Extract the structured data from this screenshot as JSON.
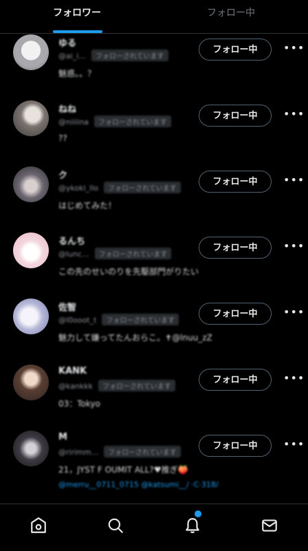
{
  "tabs": [
    {
      "label": "フォロワー"
    },
    {
      "label": "フォロー中"
    }
  ],
  "follow_label": "フォロー中",
  "more_label": "•••",
  "users": [
    {
      "name": "ゆる",
      "handle": "@ai_i...",
      "badge": "フォローされています",
      "bio": "魅惑。。？",
      "bio2": ""
    },
    {
      "name": "ねね",
      "handle": "@niiiina",
      "badge": "フォローされています",
      "bio": "??",
      "bio2": ""
    },
    {
      "name": "ク",
      "handle": "@ykoki_llo",
      "badge": "フォローされています",
      "bio": "はじめてみた！",
      "bio2": ""
    },
    {
      "name": "るんち",
      "handle": "@lunc...",
      "badge": "フォローされています",
      "bio": "この先のせいのりを先駆部門がりたい",
      "bio2": ""
    },
    {
      "name": "佐智",
      "handle": "@l0ooot_t",
      "badge": "フォローされています",
      "bio": "魅力して嫌ってたんおらこ。✝@lnuu_zZ",
      "bio2": ""
    },
    {
      "name": "KANK",
      "handle": "@kankkk",
      "badge": "フォローされています",
      "bio": "03：Tokyo",
      "bio2": ""
    },
    {
      "name": "M",
      "handle": "@ririmm...",
      "badge": "フォローされています",
      "bio": "21，JYST F OUMIT ALL?♥推ぎ🍑",
      "bio2": "@merru__0711_0715 @katsumi__/ ·C·318/"
    }
  ],
  "colors": {
    "accent": "#1d9bf0",
    "background": "#000000",
    "heart": "#e0245e"
  },
  "bottom_nav": [
    "home-icon",
    "search-icon",
    "notifications-icon",
    "messages-icon"
  ]
}
